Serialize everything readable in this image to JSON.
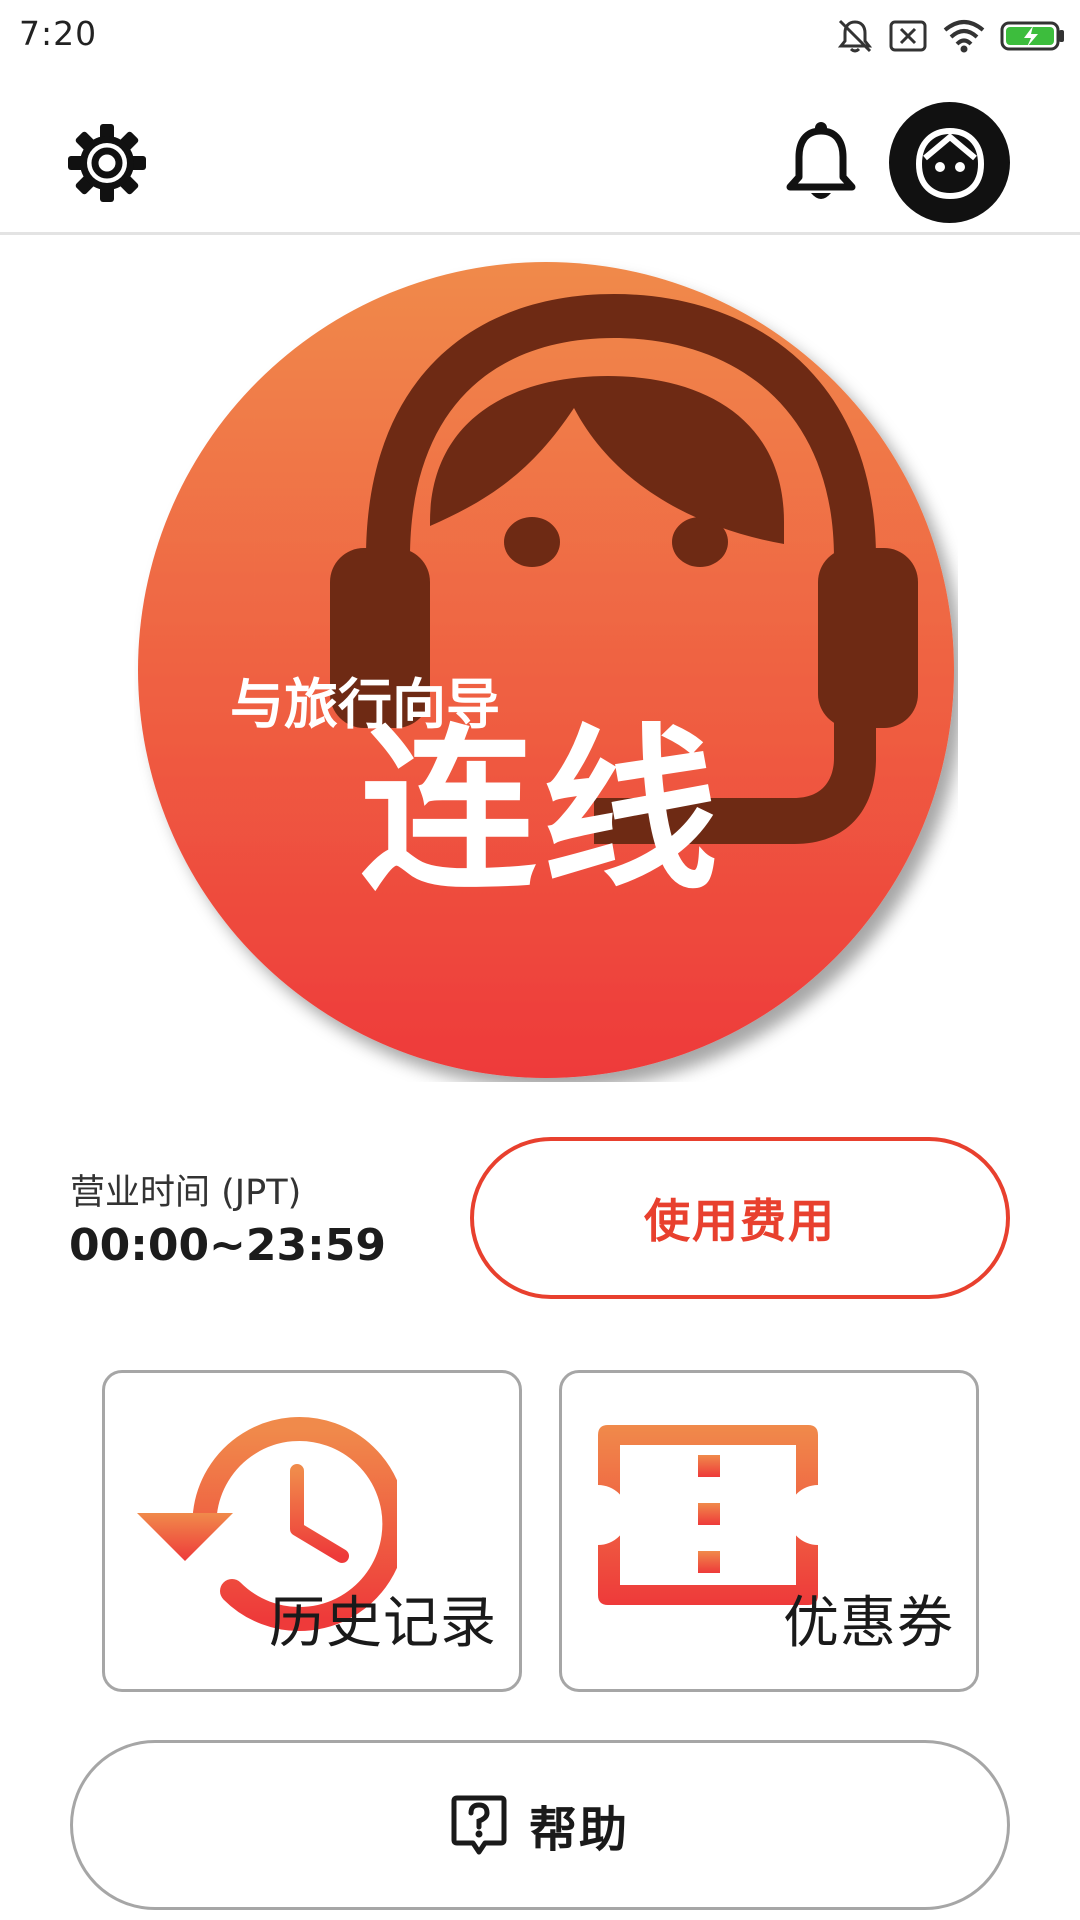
{
  "status_bar": {
    "time": "7:20",
    "icons": [
      "notifications-muted-icon",
      "no-sim-icon",
      "wifi-icon",
      "battery-charging-icon"
    ]
  },
  "toolbar": {
    "settings_icon": "gear-icon",
    "notifications_icon": "bell-icon",
    "profile_icon": "avatar-icon"
  },
  "connect": {
    "subtitle": "与旅行向导",
    "title": "连线",
    "icon": "headset-agent-icon"
  },
  "hours": {
    "label": "营业时间 (JPT)",
    "value": "00:00~23:59"
  },
  "fee_button": {
    "label": "使用费用"
  },
  "tiles": [
    {
      "label": "历史记录",
      "icon": "history-icon"
    },
    {
      "label": "优惠券",
      "icon": "ticket-icon"
    }
  ],
  "help_button": {
    "label": "帮助",
    "icon": "help-question-icon"
  },
  "colors": {
    "accent": "#e8402e",
    "gradient_top": "#f08a4b",
    "gradient_bottom": "#ee3a3a",
    "headset": "#6e2a14",
    "tile_border": "#a6a6a6",
    "battery": "#3dbd3d"
  }
}
